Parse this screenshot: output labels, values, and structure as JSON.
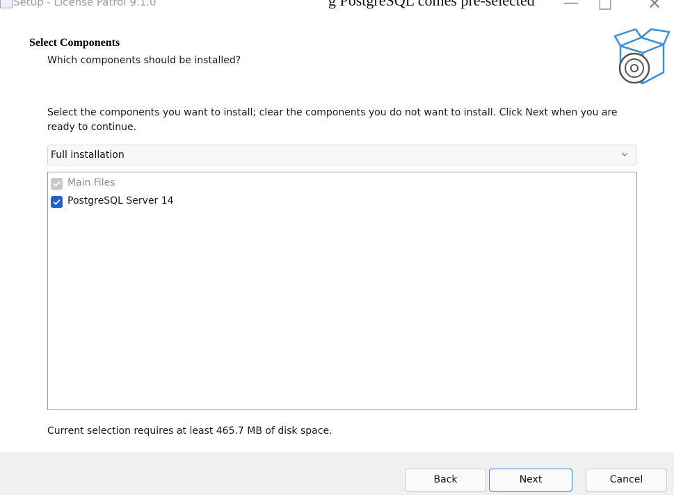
{
  "window": {
    "title": "Setup - License Patrol 9.1.0",
    "overlay_text": "g PostgreSQL comes pre-selected"
  },
  "header": {
    "title": "Select Components",
    "subtitle": "Which components should be installed?"
  },
  "instructions": "Select the components you want to install; clear the components you do not want to install. Click Next when you are ready to continue.",
  "install_type": {
    "selected": "Full installation"
  },
  "components": [
    {
      "label": "Main Files",
      "checked": true,
      "disabled": true
    },
    {
      "label": "PostgreSQL Server 14",
      "checked": true,
      "disabled": false
    }
  ],
  "disk_space": "Current selection requires at least 465.7 MB of disk space.",
  "buttons": {
    "back": "Back",
    "next": "Next",
    "cancel": "Cancel"
  },
  "colors": {
    "accent": "#1f63c9",
    "disabled_check": "#c9c9c9",
    "footer_bg": "#f0f0f0"
  }
}
